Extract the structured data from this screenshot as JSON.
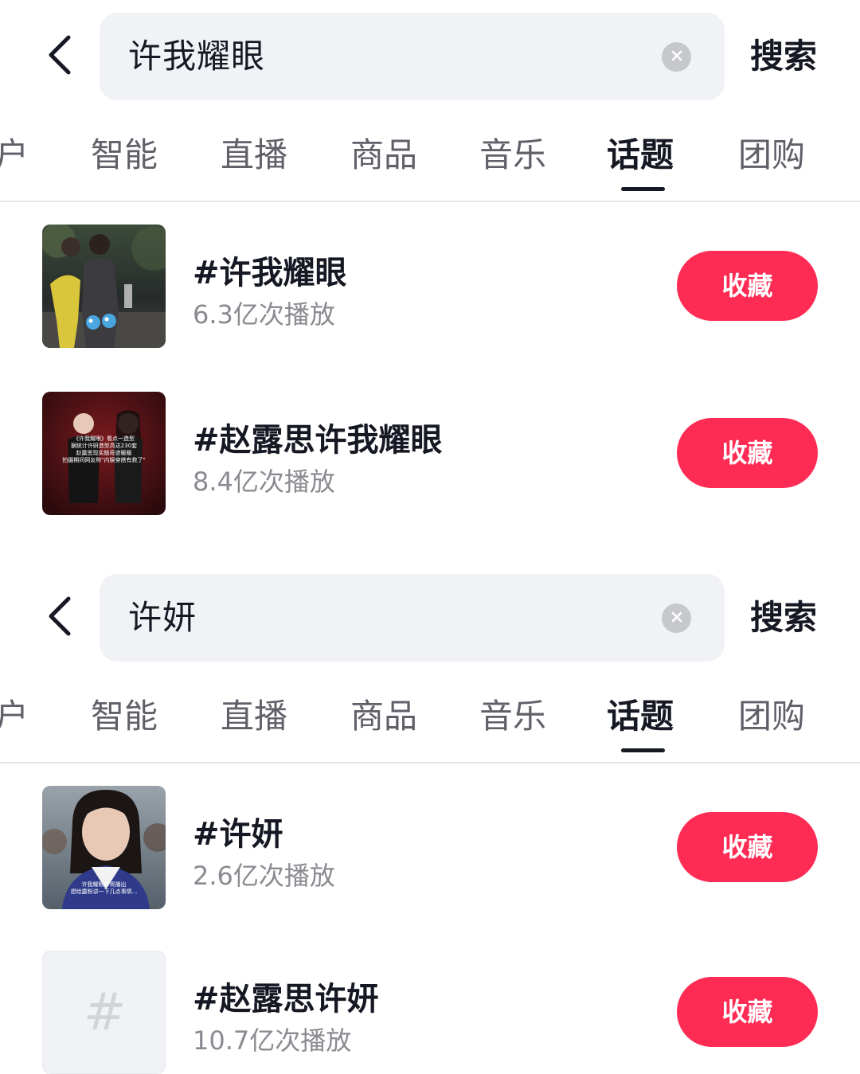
{
  "panels": [
    {
      "query": "许我耀眼",
      "search_label": "搜索",
      "tabs": [
        {
          "label": "户"
        },
        {
          "label": "智能"
        },
        {
          "label": "直播"
        },
        {
          "label": "商品"
        },
        {
          "label": "音乐"
        },
        {
          "label": "话题",
          "active": true
        },
        {
          "label": "团购"
        }
      ],
      "topics": [
        {
          "title": "#许我耀眼",
          "count": "6.3亿次播放",
          "button": "收藏",
          "thumb": "night-street-photo"
        },
        {
          "title": "#赵露思许我耀眼",
          "count": "8.4亿次播放",
          "button": "收藏",
          "thumb": "red-poster-photo",
          "thumb_caption": [
            "《许我耀眼》看点一造型",
            "据统计许妍造型高达230套",
            "赵露思现实版奇迹暖暖",
            "拍摄期间网友称\"内娱穿搭有救了\""
          ]
        }
      ]
    },
    {
      "query": "许妍",
      "search_label": "搜索",
      "tabs": [
        {
          "label": "户"
        },
        {
          "label": "智能"
        },
        {
          "label": "直播"
        },
        {
          "label": "商品"
        },
        {
          "label": "音乐"
        },
        {
          "label": "话题",
          "active": true
        },
        {
          "label": "团购"
        }
      ],
      "topics": [
        {
          "title": "#许妍",
          "count": "2.6亿次播放",
          "button": "收藏",
          "thumb": "student-photo",
          "thumb_caption": [
            "许我耀眼即将播出",
            "想给露粉讲一下几点事情..."
          ]
        },
        {
          "title": "#赵露思许妍",
          "count": "10.7亿次播放",
          "button": "收藏",
          "thumb": "hashtag-placeholder",
          "thumb_symbol": "#"
        }
      ]
    }
  ],
  "colors": {
    "accent": "#fe2c55",
    "search_bg": "#f1f2f5",
    "text_primary": "#161823",
    "text_secondary": "#8a8b91"
  }
}
